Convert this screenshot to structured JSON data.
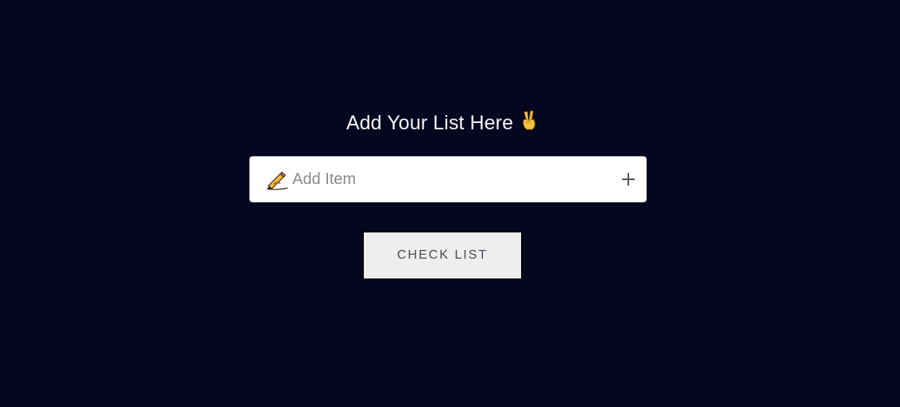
{
  "header": {
    "title": "Add Your List Here",
    "title_emoji": "✌"
  },
  "item_form": {
    "placeholder": "Add Item",
    "value": "",
    "leading_icon": "pencil-writing-icon",
    "add_icon": "plus-icon"
  },
  "actions": {
    "check_list_label": "CHECK LIST"
  },
  "colors": {
    "background": "#05061f",
    "input_background": "#ffffff",
    "button_background": "#eeeeee",
    "heading_text": "#f4f4f6"
  }
}
